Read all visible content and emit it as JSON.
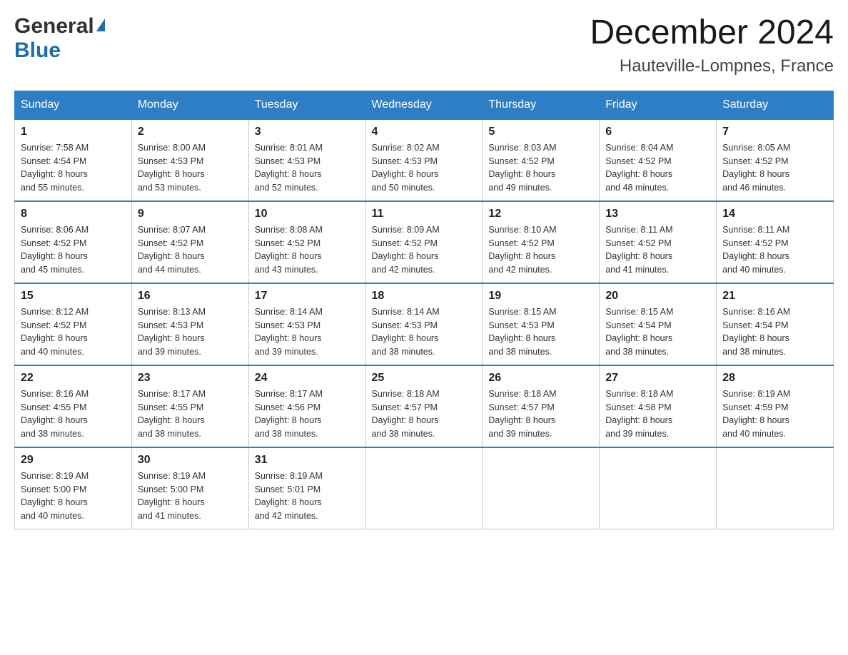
{
  "header": {
    "logo_general": "General",
    "logo_blue": "Blue",
    "month_title": "December 2024",
    "location": "Hauteville-Lompnes, France"
  },
  "days_of_week": [
    "Sunday",
    "Monday",
    "Tuesday",
    "Wednesday",
    "Thursday",
    "Friday",
    "Saturday"
  ],
  "weeks": [
    [
      {
        "day": "1",
        "sunrise": "7:58 AM",
        "sunset": "4:54 PM",
        "daylight": "8 hours and 55 minutes."
      },
      {
        "day": "2",
        "sunrise": "8:00 AM",
        "sunset": "4:53 PM",
        "daylight": "8 hours and 53 minutes."
      },
      {
        "day": "3",
        "sunrise": "8:01 AM",
        "sunset": "4:53 PM",
        "daylight": "8 hours and 52 minutes."
      },
      {
        "day": "4",
        "sunrise": "8:02 AM",
        "sunset": "4:53 PM",
        "daylight": "8 hours and 50 minutes."
      },
      {
        "day": "5",
        "sunrise": "8:03 AM",
        "sunset": "4:52 PM",
        "daylight": "8 hours and 49 minutes."
      },
      {
        "day": "6",
        "sunrise": "8:04 AM",
        "sunset": "4:52 PM",
        "daylight": "8 hours and 48 minutes."
      },
      {
        "day": "7",
        "sunrise": "8:05 AM",
        "sunset": "4:52 PM",
        "daylight": "8 hours and 46 minutes."
      }
    ],
    [
      {
        "day": "8",
        "sunrise": "8:06 AM",
        "sunset": "4:52 PM",
        "daylight": "8 hours and 45 minutes."
      },
      {
        "day": "9",
        "sunrise": "8:07 AM",
        "sunset": "4:52 PM",
        "daylight": "8 hours and 44 minutes."
      },
      {
        "day": "10",
        "sunrise": "8:08 AM",
        "sunset": "4:52 PM",
        "daylight": "8 hours and 43 minutes."
      },
      {
        "day": "11",
        "sunrise": "8:09 AM",
        "sunset": "4:52 PM",
        "daylight": "8 hours and 42 minutes."
      },
      {
        "day": "12",
        "sunrise": "8:10 AM",
        "sunset": "4:52 PM",
        "daylight": "8 hours and 42 minutes."
      },
      {
        "day": "13",
        "sunrise": "8:11 AM",
        "sunset": "4:52 PM",
        "daylight": "8 hours and 41 minutes."
      },
      {
        "day": "14",
        "sunrise": "8:11 AM",
        "sunset": "4:52 PM",
        "daylight": "8 hours and 40 minutes."
      }
    ],
    [
      {
        "day": "15",
        "sunrise": "8:12 AM",
        "sunset": "4:52 PM",
        "daylight": "8 hours and 40 minutes."
      },
      {
        "day": "16",
        "sunrise": "8:13 AM",
        "sunset": "4:53 PM",
        "daylight": "8 hours and 39 minutes."
      },
      {
        "day": "17",
        "sunrise": "8:14 AM",
        "sunset": "4:53 PM",
        "daylight": "8 hours and 39 minutes."
      },
      {
        "day": "18",
        "sunrise": "8:14 AM",
        "sunset": "4:53 PM",
        "daylight": "8 hours and 38 minutes."
      },
      {
        "day": "19",
        "sunrise": "8:15 AM",
        "sunset": "4:53 PM",
        "daylight": "8 hours and 38 minutes."
      },
      {
        "day": "20",
        "sunrise": "8:15 AM",
        "sunset": "4:54 PM",
        "daylight": "8 hours and 38 minutes."
      },
      {
        "day": "21",
        "sunrise": "8:16 AM",
        "sunset": "4:54 PM",
        "daylight": "8 hours and 38 minutes."
      }
    ],
    [
      {
        "day": "22",
        "sunrise": "8:16 AM",
        "sunset": "4:55 PM",
        "daylight": "8 hours and 38 minutes."
      },
      {
        "day": "23",
        "sunrise": "8:17 AM",
        "sunset": "4:55 PM",
        "daylight": "8 hours and 38 minutes."
      },
      {
        "day": "24",
        "sunrise": "8:17 AM",
        "sunset": "4:56 PM",
        "daylight": "8 hours and 38 minutes."
      },
      {
        "day": "25",
        "sunrise": "8:18 AM",
        "sunset": "4:57 PM",
        "daylight": "8 hours and 38 minutes."
      },
      {
        "day": "26",
        "sunrise": "8:18 AM",
        "sunset": "4:57 PM",
        "daylight": "8 hours and 39 minutes."
      },
      {
        "day": "27",
        "sunrise": "8:18 AM",
        "sunset": "4:58 PM",
        "daylight": "8 hours and 39 minutes."
      },
      {
        "day": "28",
        "sunrise": "8:19 AM",
        "sunset": "4:59 PM",
        "daylight": "8 hours and 40 minutes."
      }
    ],
    [
      {
        "day": "29",
        "sunrise": "8:19 AM",
        "sunset": "5:00 PM",
        "daylight": "8 hours and 40 minutes."
      },
      {
        "day": "30",
        "sunrise": "8:19 AM",
        "sunset": "5:00 PM",
        "daylight": "8 hours and 41 minutes."
      },
      {
        "day": "31",
        "sunrise": "8:19 AM",
        "sunset": "5:01 PM",
        "daylight": "8 hours and 42 minutes."
      },
      null,
      null,
      null,
      null
    ]
  ],
  "labels": {
    "sunrise": "Sunrise:",
    "sunset": "Sunset:",
    "daylight": "Daylight:"
  }
}
